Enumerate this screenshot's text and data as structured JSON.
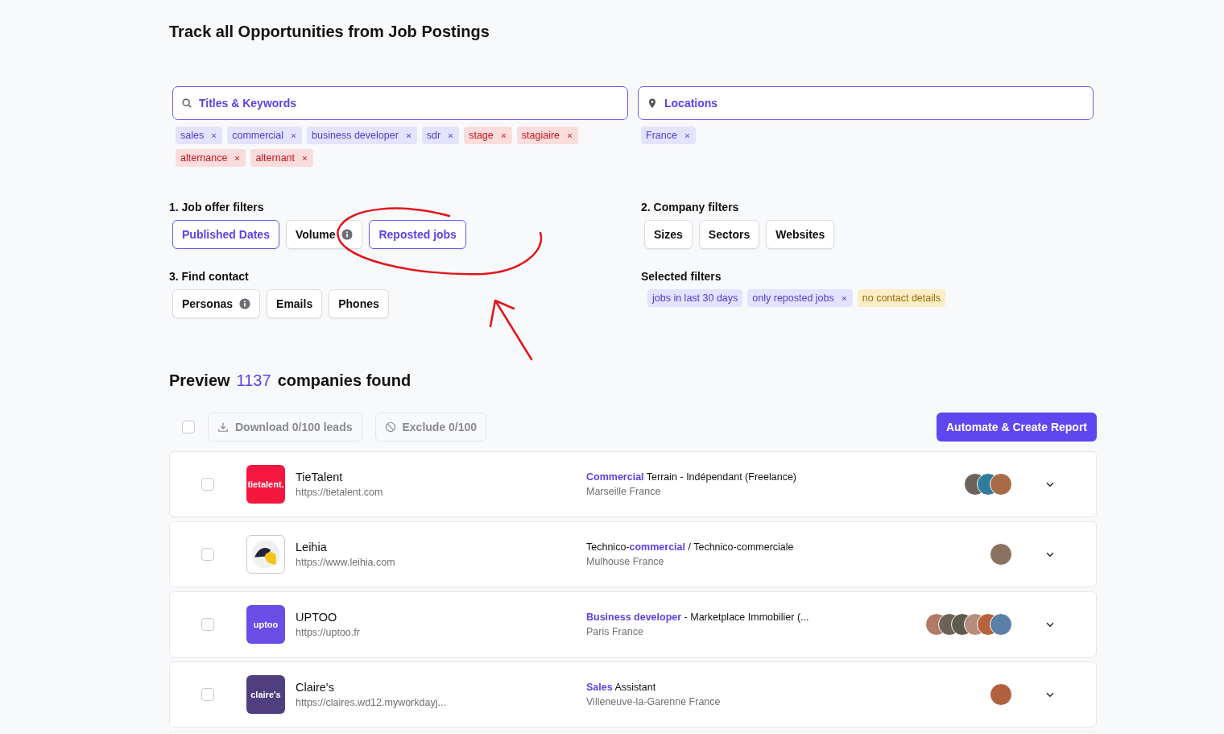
{
  "page_title": "Track all Opportunities from Job Postings",
  "keyword_search": {
    "placeholder": "Titles & Keywords",
    "tags": [
      {
        "label": "sales",
        "kind": "include"
      },
      {
        "label": "commercial",
        "kind": "include"
      },
      {
        "label": "business developer",
        "kind": "include"
      },
      {
        "label": "sdr",
        "kind": "include"
      },
      {
        "label": "stage",
        "kind": "exclude"
      },
      {
        "label": "stagiaire",
        "kind": "exclude"
      },
      {
        "label": "alternance",
        "kind": "exclude"
      },
      {
        "label": "alternant",
        "kind": "exclude"
      }
    ]
  },
  "location_search": {
    "placeholder": "Locations",
    "tags": [
      {
        "label": "France",
        "kind": "include"
      }
    ]
  },
  "filter_groups": [
    {
      "title": "1. Job offer filters",
      "buttons": [
        {
          "label": "Published Dates",
          "selected": true,
          "info": false
        },
        {
          "label": "Volume",
          "selected": false,
          "info": true
        },
        {
          "label": "Reposted jobs",
          "selected": true,
          "info": false
        }
      ]
    },
    {
      "title": "2. Company filters",
      "buttons": [
        {
          "label": "Sizes",
          "selected": false,
          "info": false
        },
        {
          "label": "Sectors",
          "selected": false,
          "info": false
        },
        {
          "label": "Websites",
          "selected": false,
          "info": false
        }
      ]
    },
    {
      "title": "3. Find contact",
      "buttons": [
        {
          "label": "Personas",
          "selected": false,
          "info": true
        },
        {
          "label": "Emails",
          "selected": false,
          "info": false
        },
        {
          "label": "Phones",
          "selected": false,
          "info": false
        }
      ]
    }
  ],
  "selected_filters": {
    "title": "Selected filters",
    "tags": [
      {
        "label": "jobs in last 30 days",
        "kind": "include",
        "removable": false
      },
      {
        "label": "only reposted jobs",
        "kind": "include",
        "removable": true
      },
      {
        "label": "no contact details",
        "kind": "warning",
        "removable": false
      }
    ]
  },
  "preview": {
    "label": "Preview",
    "count": "1137",
    "suffix": "companies found"
  },
  "toolbar": {
    "select_all_checked": false,
    "download": "Download 0/100 leads",
    "exclude": "Exclude 0/100",
    "automate": "Automate & Create Report"
  },
  "companies": [
    {
      "checked": false,
      "logo": {
        "kind": "text",
        "text": "tietalent.",
        "color": "#f5173f"
      },
      "name": "TieTalent",
      "url": "https://tietalent.com",
      "job_title": "**Commercial** Terrain - Indépendant (Freelance)",
      "location": "Marseille France",
      "avatars": [
        {
          "color": "#6b6259"
        },
        {
          "color": "#2f7d9a"
        },
        {
          "color": "#a86b48"
        }
      ]
    },
    {
      "checked": false,
      "logo": {
        "kind": "bird",
        "color": "#f0f0ee"
      },
      "name": "Leihia",
      "url": "https://www.leihia.com",
      "job_title": "Technico-**commercial** / Technico-commerciale",
      "location": "Mulhouse France",
      "avatars": [
        {
          "color": "#8a7260"
        }
      ]
    },
    {
      "checked": false,
      "logo": {
        "kind": "text",
        "text": "uptoo",
        "color": "#6a4ce6"
      },
      "name": "UPTOO",
      "url": "https://uptoo.fr",
      "job_title": "**Business developer** - Marketplace Immobilier (...",
      "location": "Paris France",
      "avatars": [
        {
          "color": "#b07a66"
        },
        {
          "color": "#6c6356"
        },
        {
          "color": "#5e5a50"
        },
        {
          "color": "#b58d7c"
        },
        {
          "color": "#b7633a"
        },
        {
          "color": "#5b7fa6"
        }
      ]
    },
    {
      "checked": false,
      "logo": {
        "kind": "text",
        "text": "claire's",
        "color": "#4f3f7e"
      },
      "name": "Claire's",
      "url": "https://claires.wd12.myworkdayj...",
      "job_title": "**Sales** Assistant",
      "location": "Villeneuve-la-Garenne France",
      "avatars": [
        {
          "color": "#b0603e"
        }
      ]
    }
  ]
}
